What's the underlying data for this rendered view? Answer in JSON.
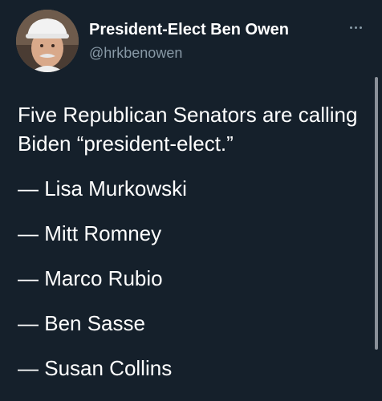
{
  "tweet": {
    "author": {
      "display_name": "President-Elect Ben Owen",
      "handle": "@hrkbenowen",
      "avatar_icon": "user-avatar-icon"
    },
    "more_icon": "more-options-icon",
    "text_intro": "Five Republican Senators are calling Biden “president-elect.”",
    "list_items": [
      "— Lisa Murkowski",
      "— Mitt Romney",
      "— Marco Rubio",
      "— Ben Sasse",
      "— Susan Collins"
    ]
  },
  "colors": {
    "background": "#15202b",
    "primary_text": "#ffffff",
    "secondary_text": "#8899a6"
  }
}
